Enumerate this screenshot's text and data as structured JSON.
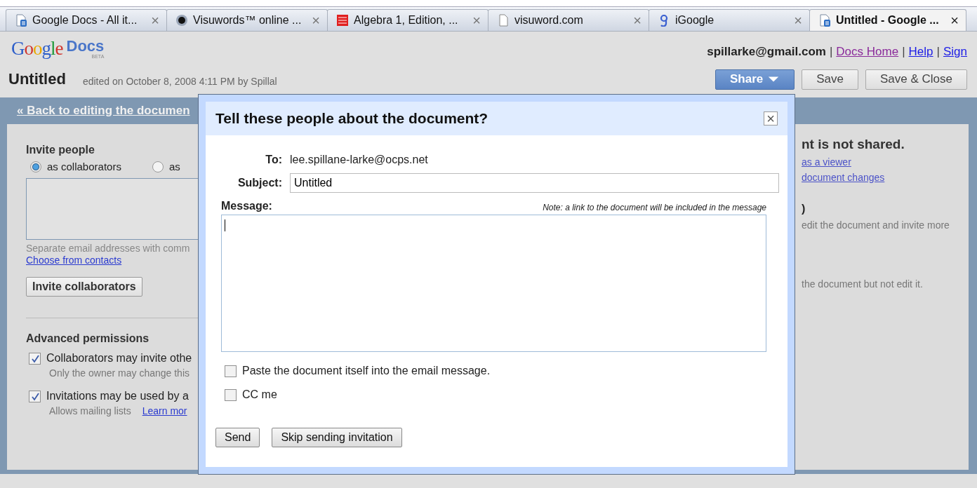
{
  "tabs": [
    {
      "label": "Google Docs - All it...",
      "kind": "doc",
      "selected": false
    },
    {
      "label": "Visuwords™ online ...",
      "kind": "orb",
      "selected": false
    },
    {
      "label": "Algebra 1, Edition, ...",
      "kind": "publisher",
      "selected": false
    },
    {
      "label": "visuword.com",
      "kind": "page",
      "selected": false
    },
    {
      "label": "iGoogle",
      "kind": "g",
      "selected": false
    },
    {
      "label": "Untitled - Google ...",
      "kind": "doc",
      "selected": true
    }
  ],
  "tab_close": "×",
  "logo": {
    "name": "Google",
    "product": "Docs",
    "badge": "BETA"
  },
  "account": {
    "email": "spillarke@gmail.com",
    "separator": "|",
    "links": [
      {
        "label": "Docs Home",
        "visited": true
      },
      {
        "label": "Help",
        "visited": false
      },
      {
        "label": "Sign",
        "visited": false
      }
    ]
  },
  "document": {
    "title": "Untitled",
    "edited": "edited on October 8, 2008 4:11 PM by Spillal"
  },
  "toolbar_buttons": [
    {
      "label": "Share",
      "kind": "menu"
    },
    {
      "label": "Save",
      "kind": "plain"
    },
    {
      "label": "Save & Close",
      "kind": "plain"
    }
  ],
  "back_link": "« Back to editing the documen",
  "invite": {
    "heading": "Invite people",
    "roles": [
      {
        "label": "as collaborators",
        "selected": true
      },
      {
        "label": "as",
        "selected": false
      }
    ],
    "hint": "Separate email addresses with comm",
    "contacts_link": "Choose from contacts",
    "button": "Invite collaborators"
  },
  "advanced": {
    "heading": "Advanced permissions",
    "options": [
      {
        "label": "Collaborators may invite othe",
        "checked": true,
        "note": "Only the owner may change this"
      },
      {
        "label": "Invitations may be used by a",
        "checked": true,
        "note": "Allows mailing lists",
        "link": "Learn mor"
      }
    ]
  },
  "sharing": {
    "status": "nt is not shared.",
    "links": [
      "as a viewer",
      "document changes"
    ],
    "role_heading": ")",
    "role_note": "edit the document and invite more",
    "viewer_note": "the document but not edit it."
  },
  "dialog": {
    "title": "Tell these people about the document?",
    "close": "×",
    "to_label": "To:",
    "to": "lee.spillane-larke@ocps.net",
    "subject_label": "Subject:",
    "subject": "Untitled",
    "message_label": "Message:",
    "note": "Note: a link to the document will be included in the message",
    "message_focused": true,
    "options": [
      {
        "label": "Paste the document itself into the email message.",
        "checked": false
      },
      {
        "label": "CC me",
        "checked": false
      }
    ],
    "buttons": [
      "Send",
      "Skip sending invitation"
    ]
  }
}
